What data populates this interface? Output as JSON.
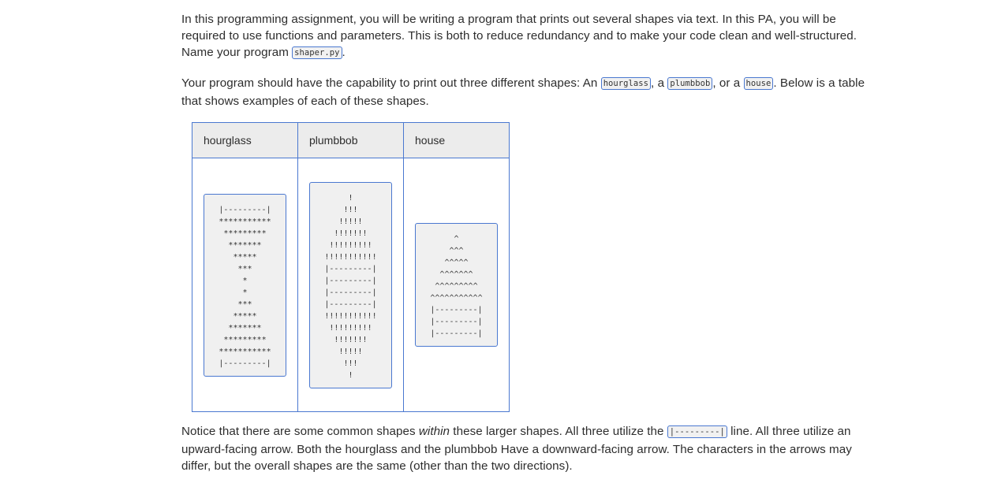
{
  "intro": {
    "p1_text": "In this programming assignment, you will be writing a program that prints out several shapes via text. In this PA, you will be required to use functions and parameters. This is both to reduce redundancy and to make your code clean and well-structured. Name your program ",
    "p1_code": "shaper.py",
    "p1_end": ".",
    "p2_a": "Your program should have the capability to print out three different shapes: An ",
    "p2_code1": "hourglass",
    "p2_b": ", a ",
    "p2_code2": "plumbbob",
    "p2_c": ", or a ",
    "p2_code3": "house",
    "p2_d": ". Below is a table that shows examples of each of these shapes."
  },
  "table": {
    "headers": [
      "hourglass",
      "plumbbob",
      "house"
    ],
    "shapes": [
      "|---------|\n***********\n*********\n*******\n*****\n***\n*\n*\n***\n*****\n*******\n*********\n***********\n|---------|",
      "!\n!!!\n!!!!!\n!!!!!!!\n!!!!!!!!!\n!!!!!!!!!!!\n|---------|\n|---------|\n|---------|\n|---------|\n!!!!!!!!!!!\n!!!!!!!!!\n!!!!!!!\n!!!!!\n!!!\n!",
      "^\n^^^\n^^^^^\n^^^^^^^\n^^^^^^^^^\n^^^^^^^^^^^\n|---------|\n|---------|\n|---------|"
    ]
  },
  "outro": {
    "a": "Notice that there are some common shapes ",
    "em": "within",
    "b": " these larger shapes. All three utilize the ",
    "code": "|---------|",
    "c": " line. All three utilize an upward-facing arrow. Both the hourglass and the plumbbob Have a downward-facing arrow. The characters in the arrows may differ, but the overall shapes are the same (other than the two directions)."
  }
}
